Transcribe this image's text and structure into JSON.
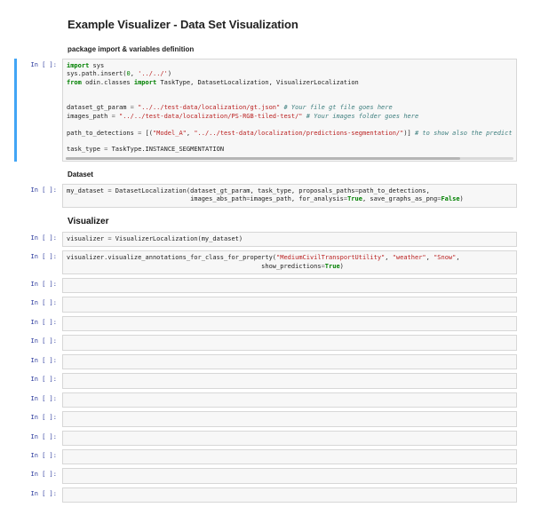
{
  "header": {
    "title": "Example Visualizer - Data Set Visualization",
    "subtitle": "package import & variables definition"
  },
  "prompts": {
    "in": "In [ ]:"
  },
  "cells": [
    {
      "kind": "code",
      "selected": true,
      "scrollable": true,
      "tokens": [
        {
          "t": "import",
          "c": "key"
        },
        {
          "t": " sys\n"
        },
        {
          "t": "sys"
        },
        {
          "t": "."
        },
        {
          "t": "path"
        },
        {
          "t": "."
        },
        {
          "t": "insert("
        },
        {
          "t": "0",
          "c": "num"
        },
        {
          "t": ", "
        },
        {
          "t": "'../../'",
          "c": "str"
        },
        {
          "t": ")\n"
        },
        {
          "t": "from",
          "c": "key"
        },
        {
          "t": " odin.classes "
        },
        {
          "t": "import",
          "c": "key"
        },
        {
          "t": " TaskType, DatasetLocalization, VisualizerLocalization\n"
        },
        {
          "t": "\n\n"
        },
        {
          "t": "dataset_gt_param "
        },
        {
          "t": "=",
          "c": "op"
        },
        {
          "t": " "
        },
        {
          "t": "\"../../test-data/localization/gt.json\"",
          "c": "str"
        },
        {
          "t": " "
        },
        {
          "t": "# Your file gt file goes here",
          "c": "com"
        },
        {
          "t": "\n"
        },
        {
          "t": "images_path "
        },
        {
          "t": "=",
          "c": "op"
        },
        {
          "t": " "
        },
        {
          "t": "\"../../test-data/localization/PS-RGB-tiled-test/\"",
          "c": "str"
        },
        {
          "t": " "
        },
        {
          "t": "# Your images folder goes here",
          "c": "com"
        },
        {
          "t": "\n"
        },
        {
          "t": "\n"
        },
        {
          "t": "path_to_detections "
        },
        {
          "t": "=",
          "c": "op"
        },
        {
          "t": " [("
        },
        {
          "t": "\"Model_A\"",
          "c": "str"
        },
        {
          "t": ", "
        },
        {
          "t": "\"../../test-data/localization/predictions-segmentation/\"",
          "c": "str"
        },
        {
          "t": ")] "
        },
        {
          "t": "# to show also the predict",
          "c": "com"
        },
        {
          "t": "\n"
        },
        {
          "t": "\n"
        },
        {
          "t": "task_type "
        },
        {
          "t": "=",
          "c": "op"
        },
        {
          "t": " TaskType"
        },
        {
          "t": "."
        },
        {
          "t": "INSTANCE_SEGMENTATION"
        }
      ]
    },
    {
      "kind": "heading",
      "text": "Dataset"
    },
    {
      "kind": "code",
      "tokens": [
        {
          "t": "my_dataset "
        },
        {
          "t": "=",
          "c": "op"
        },
        {
          "t": " DatasetLocalization(dataset_gt_param, task_type, proposals_paths"
        },
        {
          "t": "=",
          "c": "op"
        },
        {
          "t": "path_to_detections,\n"
        },
        {
          "t": "                                 images_abs_path"
        },
        {
          "t": "=",
          "c": "op"
        },
        {
          "t": "images_path, for_analysis"
        },
        {
          "t": "=",
          "c": "op"
        },
        {
          "t": "True",
          "c": "bool"
        },
        {
          "t": ", save_graphs_as_png"
        },
        {
          "t": "=",
          "c": "op"
        },
        {
          "t": "False",
          "c": "bool"
        },
        {
          "t": ")"
        }
      ]
    },
    {
      "kind": "heading-big",
      "text": "Visualizer"
    },
    {
      "kind": "code",
      "tokens": [
        {
          "t": "visualizer "
        },
        {
          "t": "=",
          "c": "op"
        },
        {
          "t": " VisualizerLocalization(my_dataset)"
        }
      ]
    },
    {
      "kind": "code",
      "tokens": [
        {
          "t": "visualizer"
        },
        {
          "t": "."
        },
        {
          "t": "visualize_annotations_for_class_for_property("
        },
        {
          "t": "\"MediumCivilTransportUtility\"",
          "c": "str"
        },
        {
          "t": ", "
        },
        {
          "t": "\"weather\"",
          "c": "str"
        },
        {
          "t": ", "
        },
        {
          "t": "\"Snow\"",
          "c": "str"
        },
        {
          "t": ",\n"
        },
        {
          "t": "                                                    show_predictions"
        },
        {
          "t": "=",
          "c": "op"
        },
        {
          "t": "True",
          "c": "bool"
        },
        {
          "t": ")"
        }
      ]
    },
    {
      "kind": "code",
      "tokens": []
    },
    {
      "kind": "code",
      "tokens": []
    },
    {
      "kind": "code",
      "tokens": []
    },
    {
      "kind": "code",
      "tokens": []
    },
    {
      "kind": "code",
      "tokens": []
    },
    {
      "kind": "code",
      "tokens": []
    },
    {
      "kind": "code",
      "tokens": []
    },
    {
      "kind": "code",
      "tokens": []
    },
    {
      "kind": "code",
      "tokens": []
    },
    {
      "kind": "code",
      "tokens": []
    },
    {
      "kind": "code",
      "tokens": []
    },
    {
      "kind": "code",
      "tokens": []
    }
  ]
}
